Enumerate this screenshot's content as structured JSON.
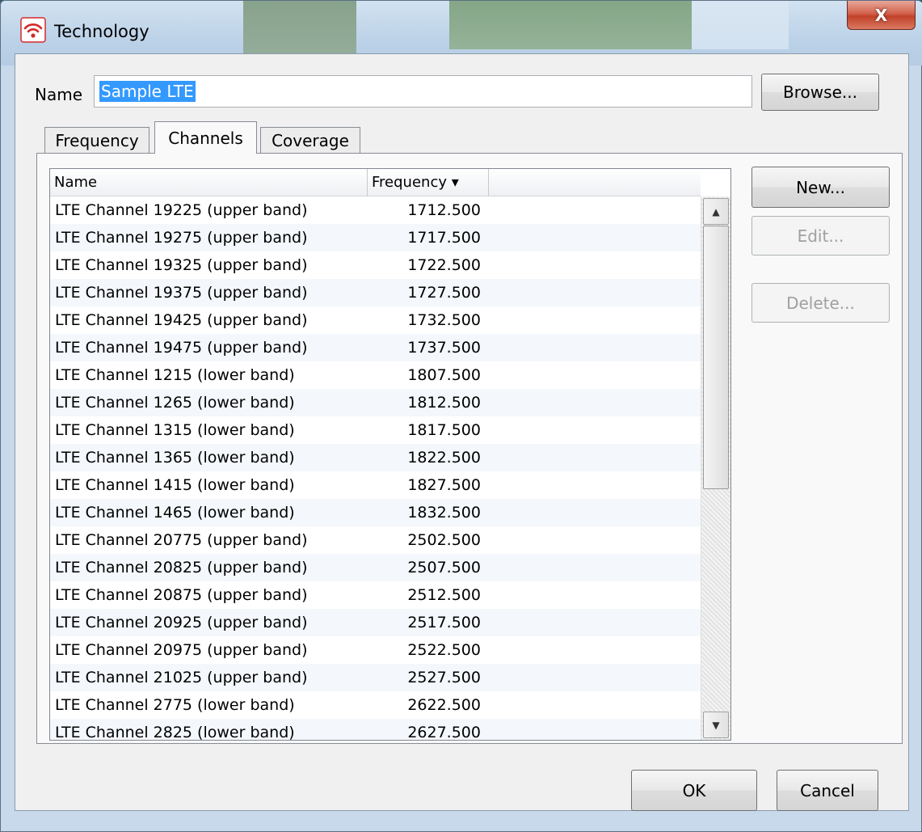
{
  "window": {
    "title": "Technology",
    "close_label": "X"
  },
  "name_field": {
    "label": "Name",
    "value": "Sample LTE"
  },
  "browse_label": "Browse...",
  "tabs": [
    {
      "label": "Frequency",
      "active": false
    },
    {
      "label": "Channels",
      "active": true
    },
    {
      "label": "Coverage",
      "active": false
    }
  ],
  "channels_table": {
    "columns": [
      "Name",
      "Frequency ▾"
    ],
    "rows": [
      {
        "name": "LTE Channel 19225 (upper band)",
        "frequency": "1712.500"
      },
      {
        "name": "LTE Channel 19275 (upper band)",
        "frequency": "1717.500"
      },
      {
        "name": "LTE Channel 19325 (upper band)",
        "frequency": "1722.500"
      },
      {
        "name": "LTE Channel 19375 (upper band)",
        "frequency": "1727.500"
      },
      {
        "name": "LTE Channel 19425 (upper band)",
        "frequency": "1732.500"
      },
      {
        "name": "LTE Channel 19475 (upper band)",
        "frequency": "1737.500"
      },
      {
        "name": "LTE Channel 1215 (lower band)",
        "frequency": "1807.500"
      },
      {
        "name": "LTE Channel 1265 (lower band)",
        "frequency": "1812.500"
      },
      {
        "name": "LTE Channel 1315 (lower band)",
        "frequency": "1817.500"
      },
      {
        "name": "LTE Channel 1365 (lower band)",
        "frequency": "1822.500"
      },
      {
        "name": "LTE Channel 1415 (lower band)",
        "frequency": "1827.500"
      },
      {
        "name": "LTE Channel 1465 (lower band)",
        "frequency": "1832.500"
      },
      {
        "name": "LTE Channel 20775 (upper band)",
        "frequency": "2502.500"
      },
      {
        "name": "LTE Channel 20825 (upper band)",
        "frequency": "2507.500"
      },
      {
        "name": "LTE Channel 20875 (upper band)",
        "frequency": "2512.500"
      },
      {
        "name": "LTE Channel 20925 (upper band)",
        "frequency": "2517.500"
      },
      {
        "name": "LTE Channel 20975 (upper band)",
        "frequency": "2522.500"
      },
      {
        "name": "LTE Channel 21025 (upper band)",
        "frequency": "2527.500"
      },
      {
        "name": "LTE Channel 2775 (lower band)",
        "frequency": "2622.500"
      },
      {
        "name": "LTE Channel 2825 (lower band)",
        "frequency": "2627.500"
      }
    ]
  },
  "side_buttons": {
    "new_label": "New...",
    "edit_label": "Edit...",
    "delete_label": "Delete..."
  },
  "footer": {
    "ok_label": "OK",
    "cancel_label": "Cancel"
  },
  "icons": {
    "app": "wifi-signal-icon",
    "scroll_up": "arrow-up-icon",
    "scroll_down": "arrow-down-icon",
    "sort": "sort-descending-icon"
  },
  "colors": {
    "app_icon": "#d42a2a",
    "selection": "#3399ff",
    "close_button": "#c2412a"
  }
}
